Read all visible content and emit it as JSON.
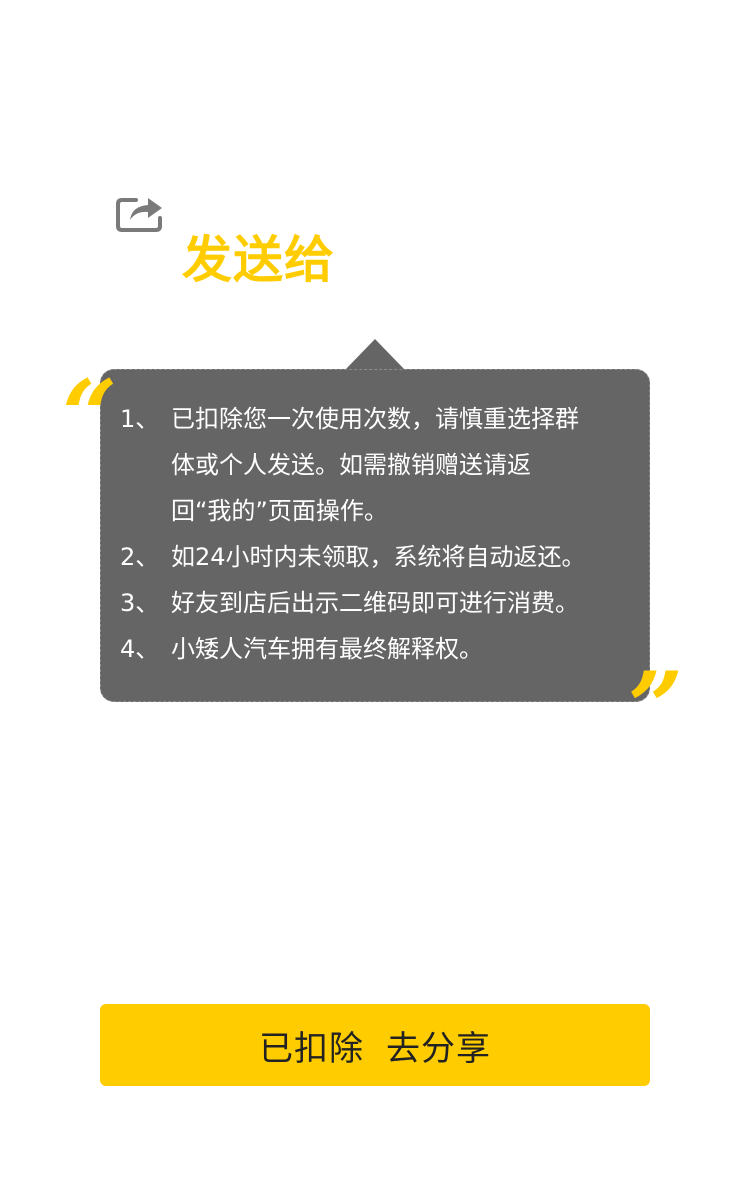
{
  "header": {
    "share_icon": "share-arrow-icon",
    "title": "发送给"
  },
  "notice": {
    "open_quote": "“",
    "close_quote": "”",
    "items": [
      {
        "num": "1、",
        "lines": [
          "已扣除您一次使用次数，请慎重选择群",
          "体或个人发送。如需撤销赠送请返",
          "回“我的”页面操作。"
        ]
      },
      {
        "num": "2、",
        "lines": [
          "如24小时内未领取，系统将自动返还。"
        ]
      },
      {
        "num": "3、",
        "lines": [
          "好友到店后出示二维码即可进行消费。"
        ]
      },
      {
        "num": "4、",
        "lines": [
          "小矮人汽车拥有最终解释权。"
        ]
      }
    ]
  },
  "action": {
    "button_part1": "已扣除",
    "button_part2": "去分享"
  },
  "colors": {
    "accent": "#FFCC00",
    "card": "#656565",
    "icon": "#7a7a7a"
  }
}
